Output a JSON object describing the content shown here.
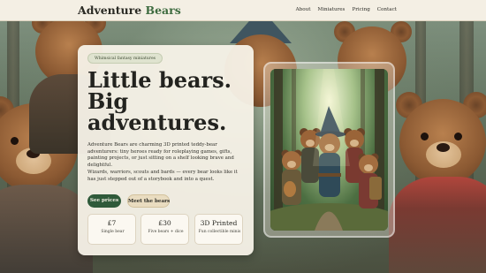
{
  "header": {
    "brand_first": "Adventure",
    "brand_second": "Bears",
    "nav": [
      "About",
      "Miniatures",
      "Pricing",
      "Contact"
    ]
  },
  "hero": {
    "tag": "Whimsical fantasy miniatures",
    "headline_1": "Little bears.",
    "headline_2": "Big",
    "headline_3": "adventures.",
    "lead": "Adventure Bears are charming 3D printed teddy-bear adventurers: tiny heroes ready for roleplaying games, gifts, painting projects, or just sitting on a shelf looking brave and delightful.",
    "sub": "Wizards, warriors, scouts and bards — every bear looks like it has just stepped out of a storybook and into a quest.",
    "primary_button": "See prices",
    "secondary_button": "Meet the bears",
    "stats": [
      {
        "value": "£7",
        "label": "Single bear"
      },
      {
        "value": "£30",
        "label": "Five bears + dice"
      },
      {
        "value": "3D Printed",
        "label": "Fun collectible minis"
      }
    ]
  },
  "colors": {
    "accent_green": "#3d6b3f",
    "button_green": "#2f5a3a",
    "card_bg": "#f7f2e8",
    "header_bg": "#f4efe4"
  },
  "icons": [
    "hero-illustration",
    "background-bears-illustration"
  ]
}
